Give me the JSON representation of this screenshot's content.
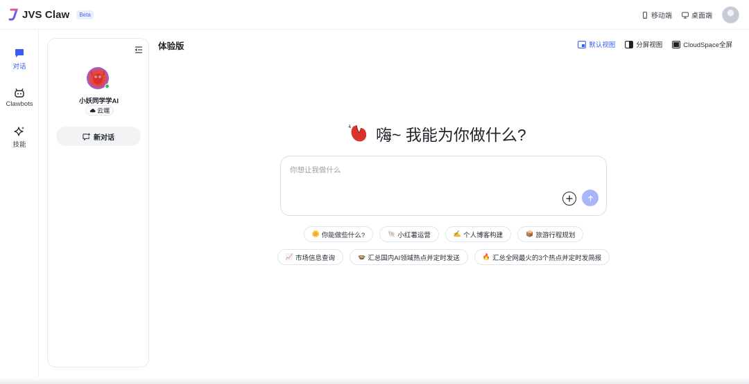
{
  "brand": {
    "name": "JVS Claw",
    "badge": "Beta"
  },
  "topbar": {
    "mobile_label": "移动端",
    "desktop_label": "桌面端"
  },
  "nav": {
    "items": [
      {
        "label": "对话",
        "icon": "chat-icon",
        "active": true
      },
      {
        "label": "Clawbots",
        "icon": "bot-icon",
        "active": false
      },
      {
        "label": "技能",
        "icon": "sparkle-icon",
        "active": false
      }
    ]
  },
  "sidepanel": {
    "bot_name": "小妖同学学AI",
    "cloud_tag": "云端",
    "new_chat_label": "新对话"
  },
  "main": {
    "title": "体验版",
    "views": [
      {
        "label": "默认视图",
        "active": true
      },
      {
        "label": "分屏视图",
        "active": false
      },
      {
        "label": "CloudSpace全屏",
        "active": false
      }
    ],
    "greeting": "嗨~ 我能为你做什么?",
    "input_placeholder": "你想让我做什么",
    "suggestions_row1": [
      {
        "emoji": "🌼",
        "label": "你能做些什么?"
      },
      {
        "emoji": "🐚",
        "label": "小红薯运营"
      },
      {
        "emoji": "✍️",
        "label": "个人博客构建"
      },
      {
        "emoji": "📦",
        "label": "旅游行程规划"
      }
    ],
    "suggestions_row2": [
      {
        "emoji": "📈",
        "label": "市场信息查询"
      },
      {
        "emoji": "🍲",
        "label": "汇总国内AI领域热点并定时发送"
      },
      {
        "emoji": "🔥",
        "label": "汇总全网最火的3个热点并定时发简报"
      }
    ]
  },
  "colors": {
    "accent": "#3a5cf5",
    "send_button": "#a7b5fb",
    "online": "#27c24c"
  }
}
